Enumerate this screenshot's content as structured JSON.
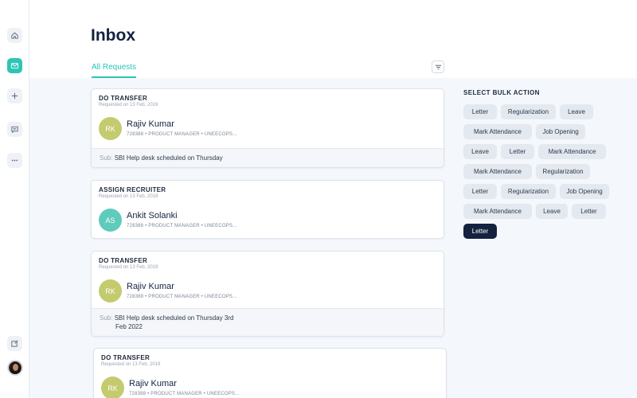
{
  "page": {
    "title": "Inbox"
  },
  "tabs": [
    {
      "label": "All Requests",
      "active": true
    }
  ],
  "sidebar": {
    "items": [
      {
        "icon": "home-icon"
      },
      {
        "icon": "mail-icon",
        "active": true
      },
      {
        "icon": "plus-icon"
      },
      {
        "icon": "chat-icon"
      },
      {
        "icon": "more-icon"
      }
    ],
    "bottom": [
      {
        "icon": "edit-icon"
      },
      {
        "icon": "user-avatar"
      }
    ]
  },
  "requests": [
    {
      "type": "DO TRANSFER",
      "requested": "Requested on 13 Feb, 2019",
      "initials": "RK",
      "name": "Rajiv Kumar",
      "meta": "728388  •  PRODUCT MANAGER  •  UNEECOPS...",
      "sub_label": "Sub:",
      "subject": "SBI Help desk scheduled on Thursday"
    },
    {
      "type": "ASSIGN RECRUITER",
      "requested": "Requested on 13 Feb, 2019",
      "initials": "AS",
      "name": "Ankit Solanki",
      "meta": "728388  •  PRODUCT MANAGER  •  UNEECOPS..."
    },
    {
      "type": "DO TRANSFER",
      "requested": "Requested on 13 Feb, 2019",
      "initials": "RK",
      "name": "Rajiv Kumar",
      "meta": "728388  •  PRODUCT MANAGER  •  UNEECOPS...",
      "sub_label": "Sub:",
      "subject_line1": "SBI Help desk scheduled on Thursday 3rd",
      "subject_line2": "Feb 2022"
    },
    {
      "type": "DO TRANSFER",
      "requested": "Requested on 13 Feb, 2019",
      "initials": "RK",
      "name": "Rajiv Kumar",
      "meta": "728388  •  PRODUCT MANAGER  •  UNEECOPS..."
    }
  ],
  "bulk": {
    "title": "SELECT BULK ACTION",
    "chips": [
      "Letter",
      "Regularization",
      "Leave",
      "Mark Attendance",
      "Job Opening",
      "Leave",
      "Letter",
      "Mark Attendance",
      "Mark Attendance",
      "Regularization",
      "Letter",
      "Regularization",
      "Job Opening",
      "Mark Attendance",
      "Leave",
      "Letter",
      "Letter"
    ],
    "selected_index": 16
  },
  "colors": {
    "accent": "#2ec4b6",
    "navy": "#142240",
    "avatar_rk": "#c3cb6e",
    "avatar_as": "#5fcbbd"
  }
}
